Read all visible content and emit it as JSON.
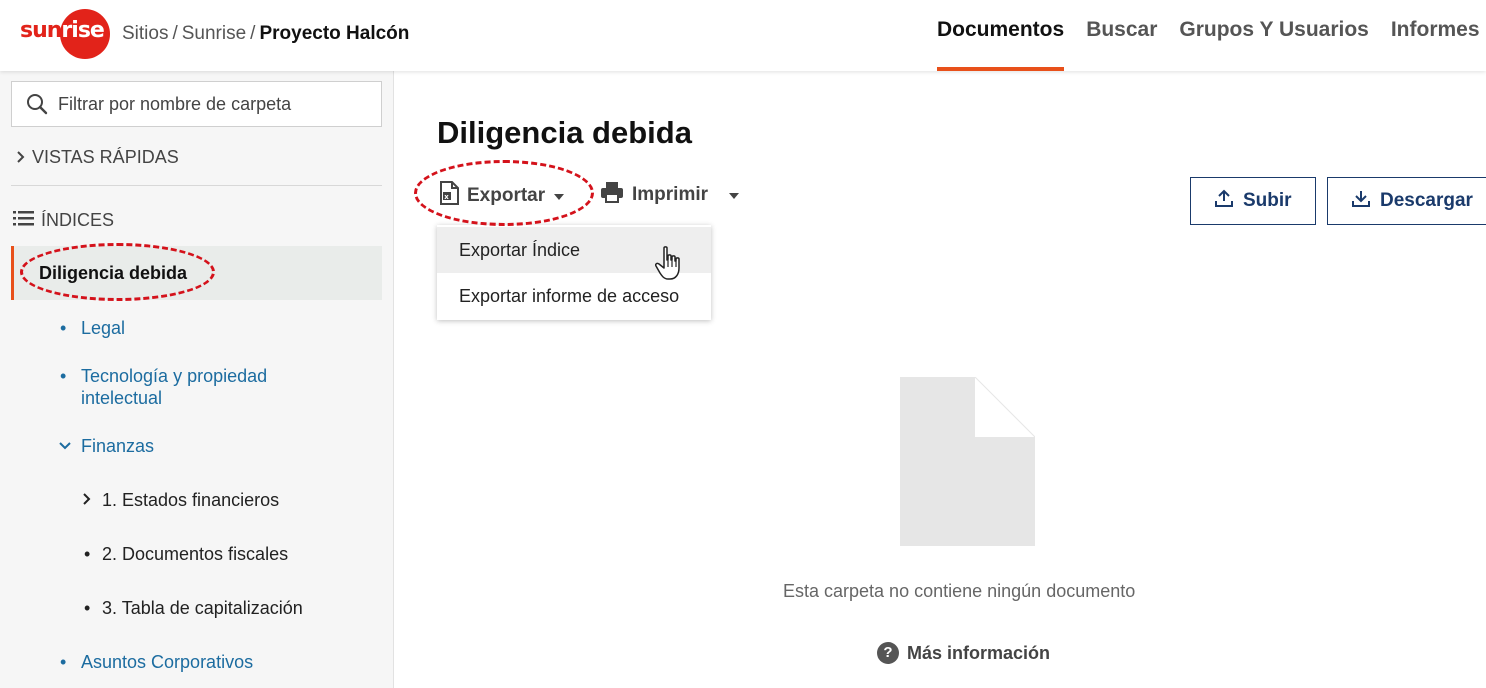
{
  "header": {
    "logo_text": "sunrise",
    "breadcrumb": [
      "Sitios",
      "Sunrise",
      "Proyecto Halcón"
    ],
    "nav": [
      "Documentos",
      "Buscar",
      "Grupos Y Usuarios",
      "Informes"
    ],
    "active_nav": "Documentos"
  },
  "sidebar": {
    "filter_placeholder": "Filtrar por nombre de carpeta",
    "quick_views": "VISTAS RÁPIDAS",
    "indices": "ÍNDICES",
    "selected_folder": "Diligencia debida",
    "items": {
      "legal": "Legal",
      "tech_line1": "Tecnología y propiedad",
      "tech_line2": "intelectual",
      "finanzas": "Finanzas",
      "sub1": "1. Estados financieros",
      "sub2": "2. Documentos fiscales",
      "sub3": "3. Tabla de capitalización",
      "asuntos": "Asuntos Corporativos"
    }
  },
  "main": {
    "title": "Diligencia debida",
    "export_label": "Exportar",
    "print_label": "Imprimir",
    "upload_label": "Subir",
    "download_label": "Descargar",
    "dropdown": [
      "Exportar Índice",
      "Exportar informe de acceso"
    ],
    "empty_message": "Esta carpeta no contiene ningún documento",
    "more_info": "Más información"
  },
  "colors": {
    "brand_red": "#e2231a",
    "accent_orange": "#e8501a",
    "link_blue": "#1c6ca0",
    "button_navy": "#1a3a6b",
    "annotation_red": "#d4121b"
  }
}
